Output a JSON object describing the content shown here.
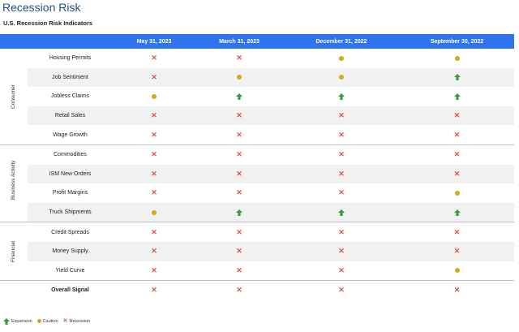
{
  "title": "Recession Risk",
  "subtitle": "U.S. Recession Risk Indicators",
  "columns": [
    "May 31, 2023",
    "March 31, 2023",
    "December 31, 2022",
    "September 30, 2022"
  ],
  "groups": [
    {
      "name": "Consumer",
      "rows": [
        {
          "label": "Housing Permits",
          "values": [
            "recession",
            "recession",
            "caution",
            "caution"
          ]
        },
        {
          "label": "Job Sentiment",
          "values": [
            "recession",
            "caution",
            "caution",
            "expansion"
          ]
        },
        {
          "label": "Jobless Claims",
          "values": [
            "caution",
            "expansion",
            "expansion",
            "expansion"
          ]
        },
        {
          "label": "Retail Sales",
          "values": [
            "recession",
            "recession",
            "recession",
            "recession"
          ]
        },
        {
          "label": "Wage Growth",
          "values": [
            "recession",
            "recession",
            "recession",
            "recession"
          ]
        }
      ]
    },
    {
      "name": "Business Activity",
      "rows": [
        {
          "label": "Commodities",
          "values": [
            "recession",
            "recession",
            "recession",
            "recession"
          ]
        },
        {
          "label": "ISM New Orders",
          "values": [
            "recession",
            "recession",
            "recession",
            "recession"
          ]
        },
        {
          "label": "Profit Margins",
          "values": [
            "recession",
            "recession",
            "recession",
            "caution"
          ]
        },
        {
          "label": "Truck Shipments",
          "values": [
            "caution",
            "expansion",
            "expansion",
            "expansion"
          ]
        }
      ]
    },
    {
      "name": "Financial",
      "rows": [
        {
          "label": "Credit Spreads",
          "values": [
            "recession",
            "recession",
            "recession",
            "recession"
          ]
        },
        {
          "label": "Money Supply",
          "values": [
            "recession",
            "recession",
            "recession",
            "recession"
          ]
        },
        {
          "label": "Yield Curve",
          "values": [
            "recession",
            "recession",
            "recession",
            "caution"
          ]
        }
      ]
    }
  ],
  "overall": {
    "label": "Overall Signal",
    "values": [
      "recession",
      "recession",
      "recession",
      "recession"
    ]
  },
  "legend": [
    {
      "status": "expansion",
      "label": "Expansion"
    },
    {
      "status": "caution",
      "label": "Caution"
    },
    {
      "status": "recession",
      "label": "Recession"
    }
  ],
  "colors": {
    "header": "#2f74ee",
    "title": "#1d4f86",
    "expansion": "#3a9a3a",
    "caution": "#d6a91a",
    "recession": "#d9534f"
  }
}
